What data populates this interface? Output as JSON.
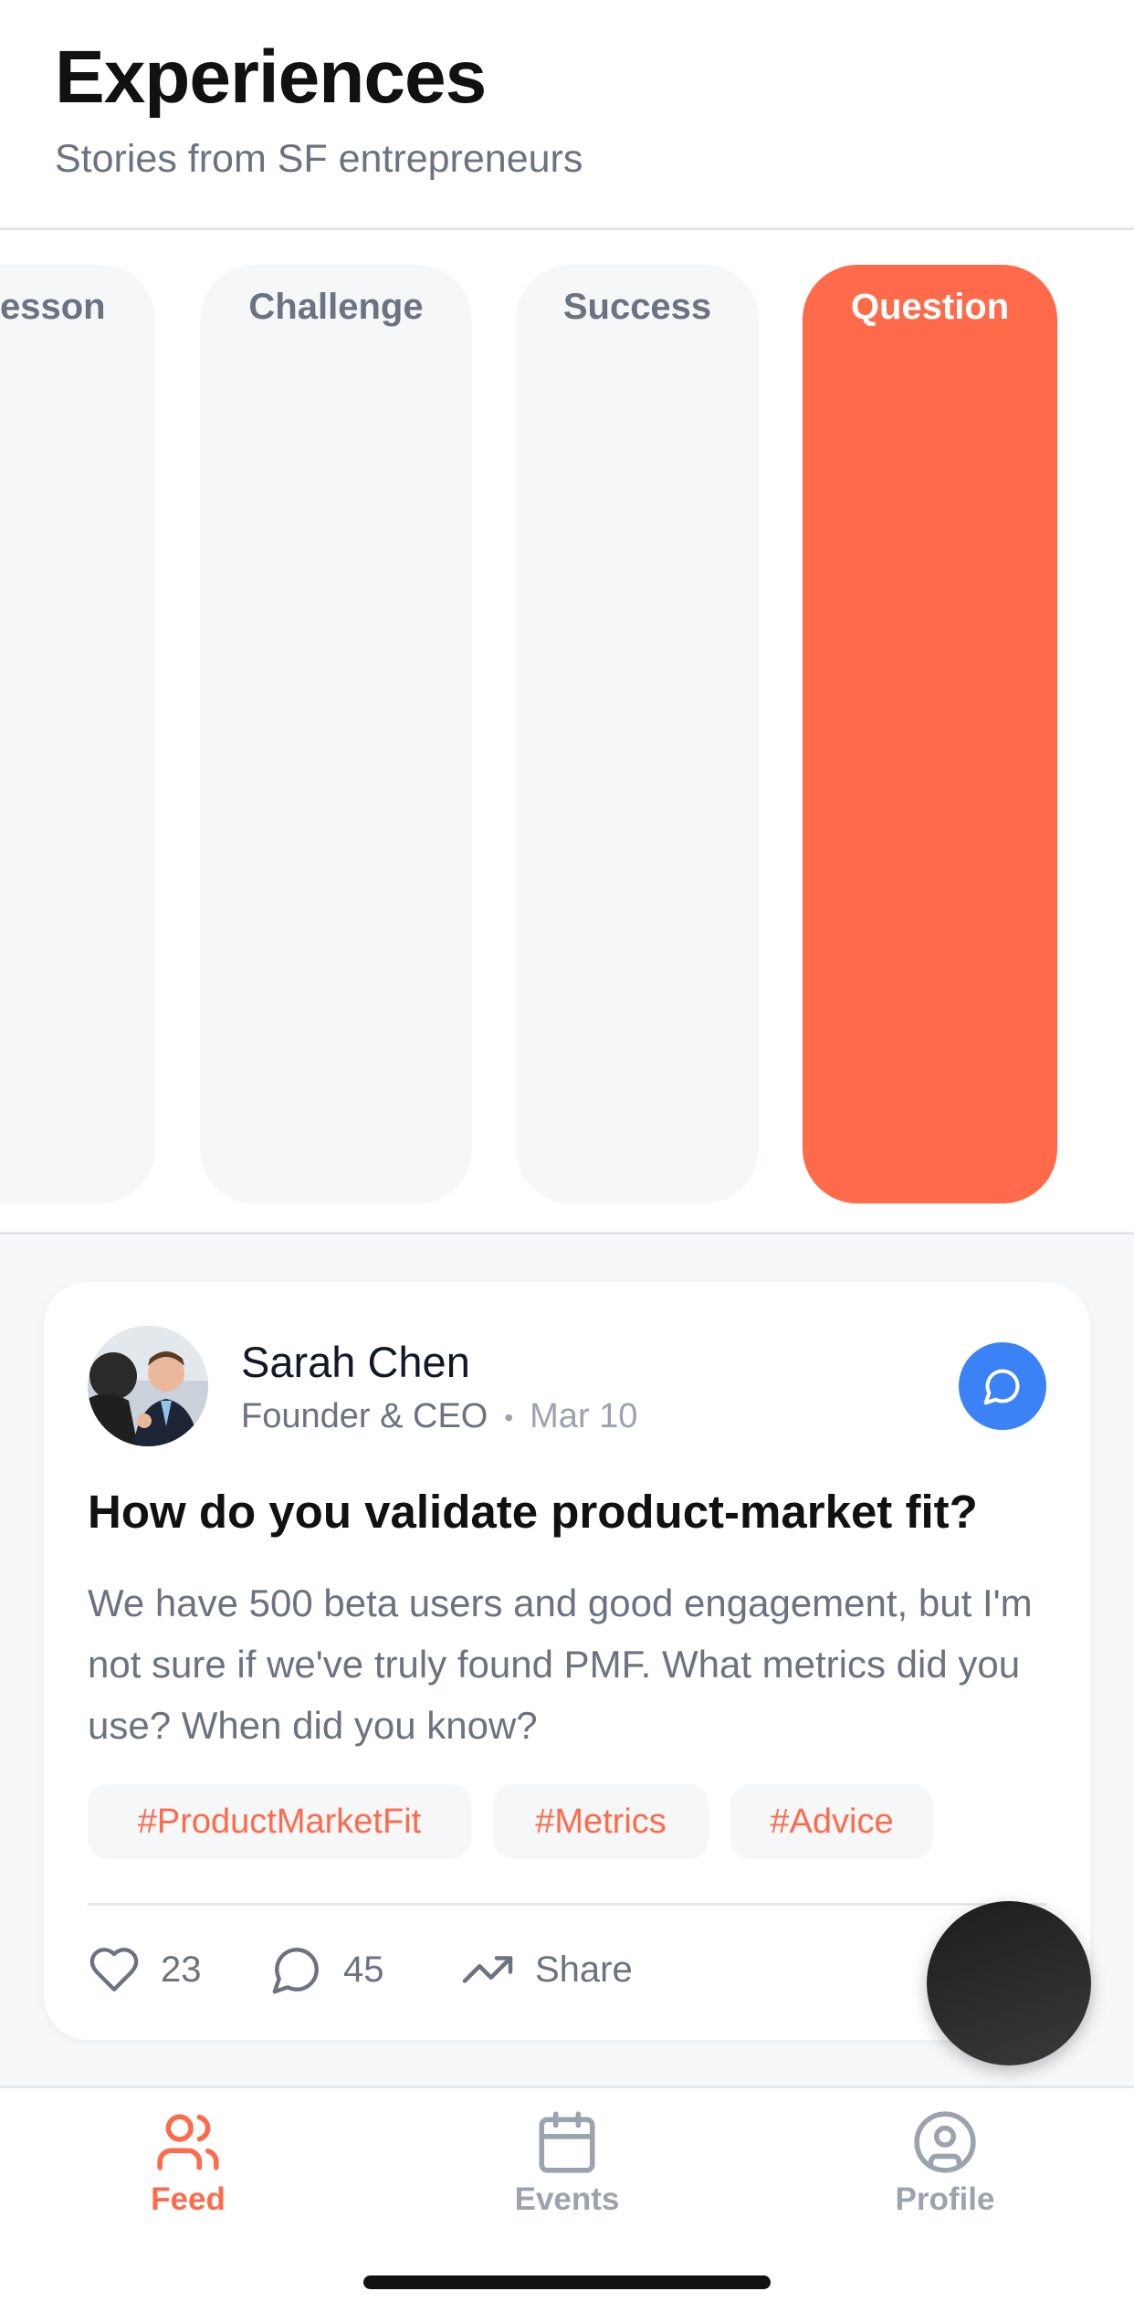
{
  "header": {
    "title": "Experiences",
    "subtitle": "Stories from SF entrepreneurs"
  },
  "filters": {
    "items": [
      {
        "label": "Lesson",
        "visible_text": "esson",
        "active": false
      },
      {
        "label": "Challenge",
        "active": false
      },
      {
        "label": "Success",
        "active": false
      },
      {
        "label": "Question",
        "active": true
      }
    ]
  },
  "post": {
    "author": {
      "name": "Sarah Chen",
      "role": "Founder & CEO",
      "separator": "•",
      "date": "Mar 10"
    },
    "title": "How do you validate product-market fit?",
    "body": "We have 500 beta users and good engagement, but I'm not sure if we've truly found PMF. What metrics did you use? When did you know?",
    "tags": [
      "#ProductMarketFit",
      "#Metrics",
      "#Advice"
    ],
    "actions": {
      "likes": "23",
      "comments": "45",
      "share_label": "Share"
    }
  },
  "tabbar": {
    "tabs": [
      {
        "label": "Feed",
        "icon": "users-icon",
        "active": true
      },
      {
        "label": "Events",
        "icon": "calendar-icon",
        "active": false
      },
      {
        "label": "Profile",
        "icon": "user-circle-icon",
        "active": false
      }
    ]
  },
  "colors": {
    "accent": "#ff6b4a",
    "chat_button": "#3b82f6",
    "chip_bg": "#f6f7f9",
    "muted_text": "#6b7280"
  }
}
